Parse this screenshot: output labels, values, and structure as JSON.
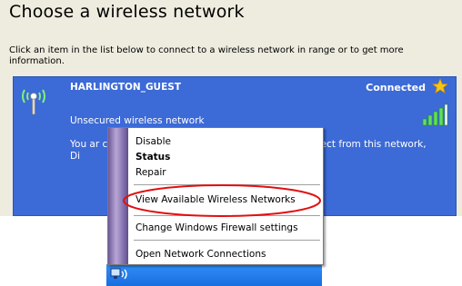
{
  "header": {
    "title": "Choose a wireless network",
    "instructions": "Click an item in the list below to connect to a wireless network in range or to get more information."
  },
  "network": {
    "name": "HARLINGTON_GUEST",
    "status": "Connected",
    "security": "Unsecured wireless network",
    "description_left": "You ar click Di",
    "description_right": "nect from this network,",
    "icons": {
      "antenna": "wireless-antenna-icon",
      "star": "star-icon",
      "signal": "signal-strength-icon"
    }
  },
  "context_menu": {
    "items": [
      "Disable",
      "Status",
      "Repair",
      "View Available Wireless Networks",
      "Change Windows Firewall settings",
      "Open Network Connections"
    ],
    "default_item": "Status",
    "circled_item": "View Available Wireless Networks"
  },
  "colors": {
    "panel_bg": "#eeecdf",
    "selected_bg": "#3c6ad6",
    "taskbar": "#1a6ee0",
    "highlight_circle": "#e01010",
    "star": "#f5c518"
  }
}
